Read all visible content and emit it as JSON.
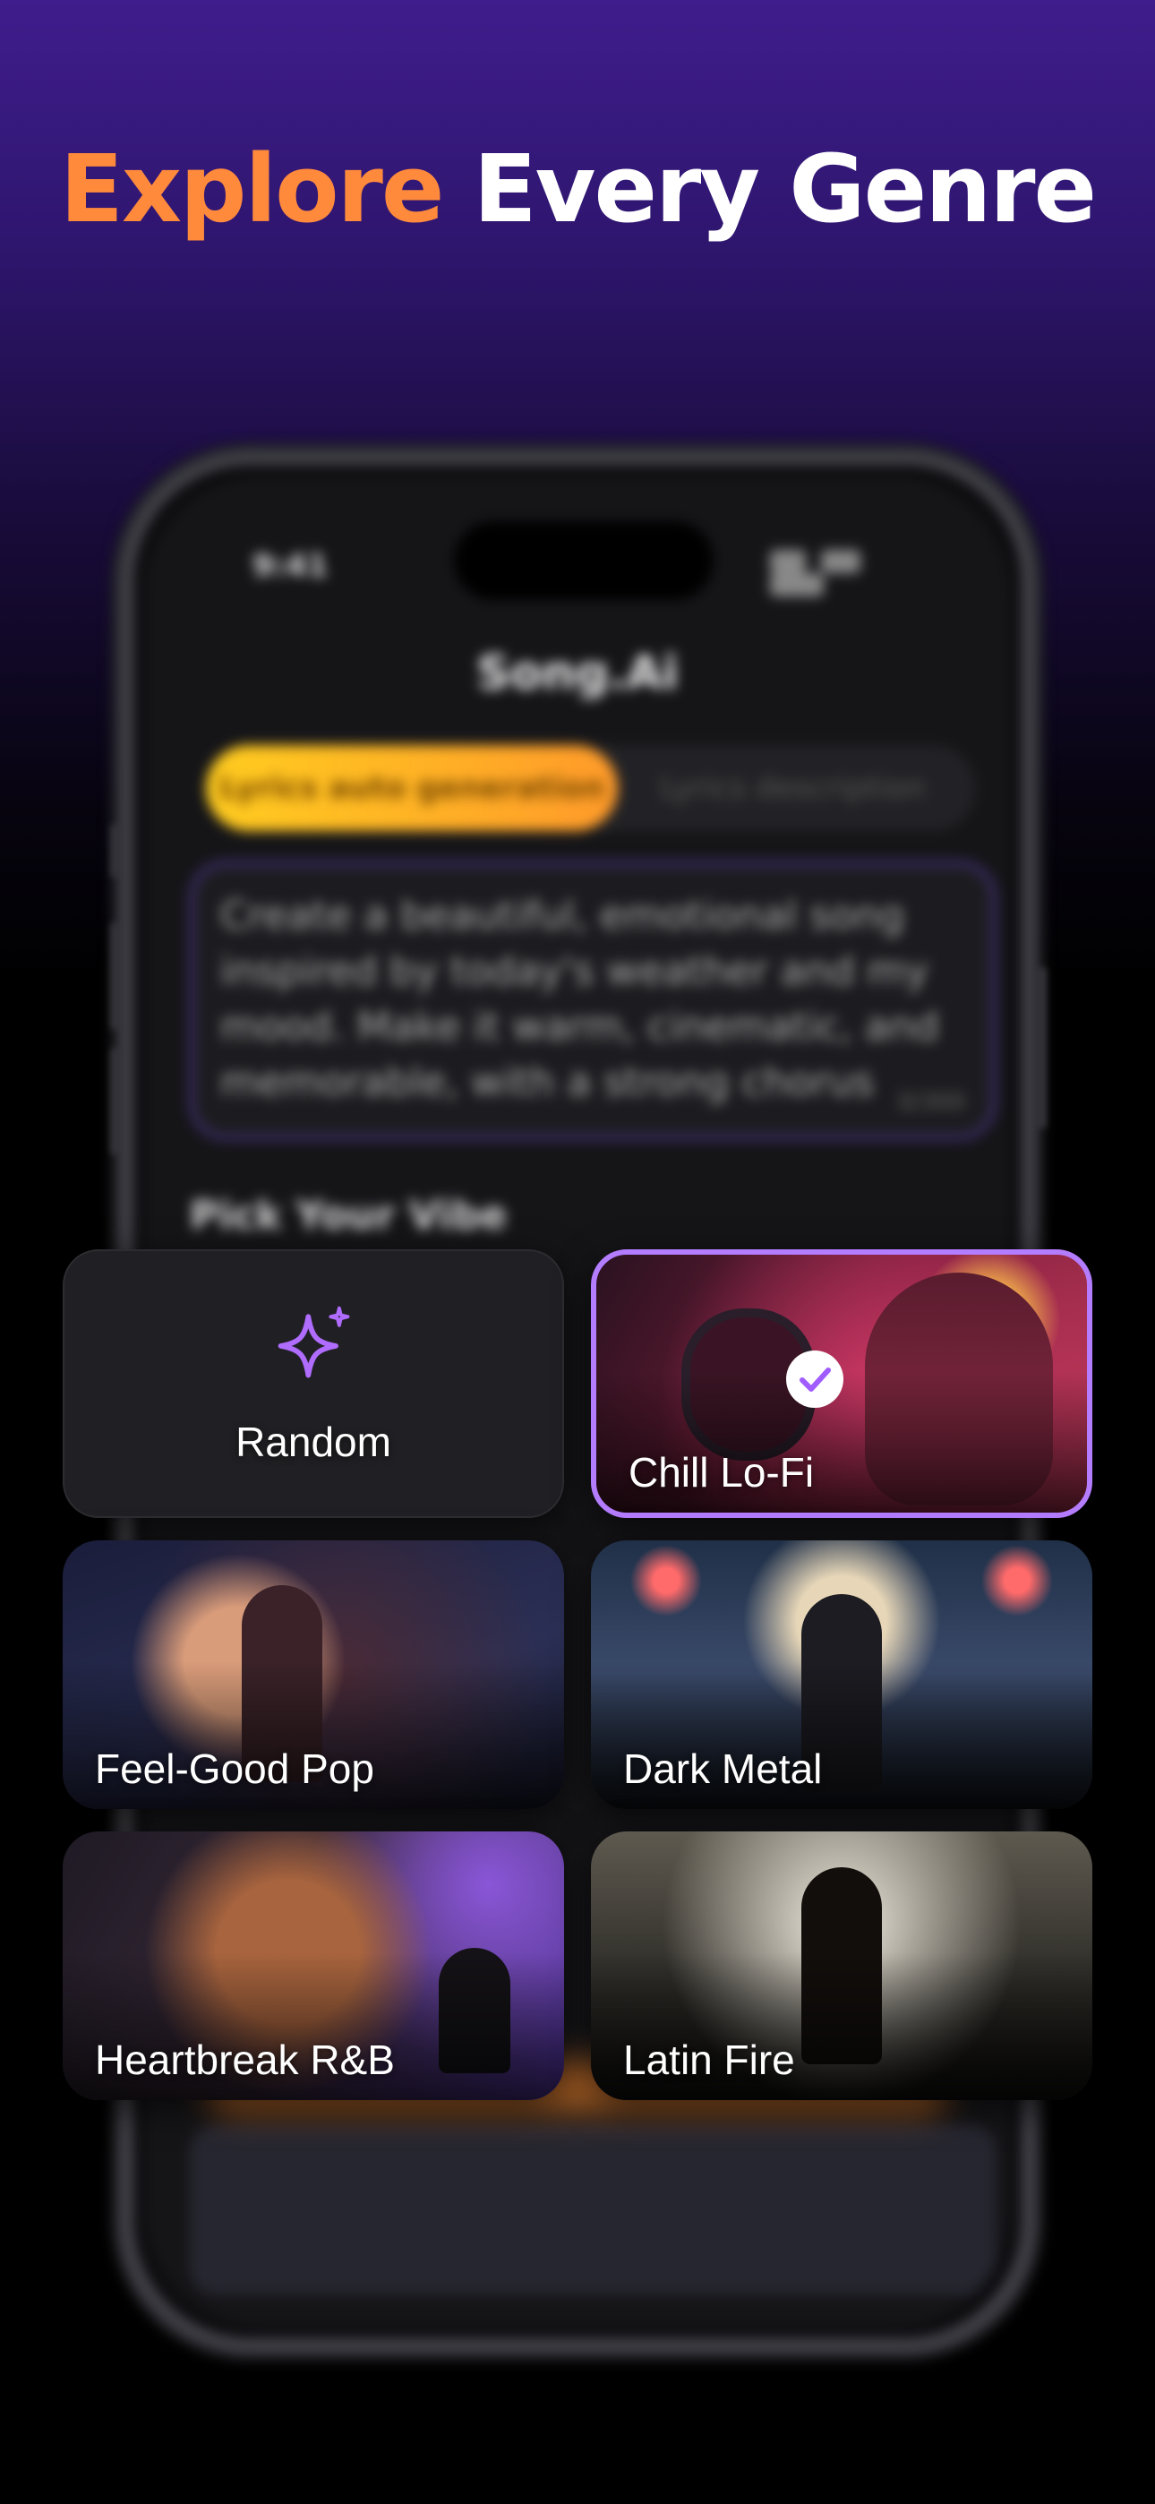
{
  "headline": {
    "accent": "Explore",
    "rest": "Every Genre"
  },
  "colors": {
    "accent": "#ff8a3c",
    "selected_border": "#b47cff",
    "sparkle": "#b06cff"
  },
  "phone": {
    "status_time": "9:41",
    "app_title": "Song.Ai",
    "tabs": {
      "active": "Lyrics auto generation",
      "inactive": "Lyrics description"
    },
    "prompt_text": "Create a beautiful, emotional song inspired by today's weather and my mood. Make it warm, cinematic, and memorable, with a strong chorus",
    "prompt_count": "0/300",
    "section_label": "Pick Your Vibe"
  },
  "genres": {
    "random": {
      "label": "Random",
      "icon": "sparkle-icon"
    },
    "lofi": {
      "label": "Chill Lo-Fi",
      "selected": true,
      "icon": "check-icon"
    },
    "pop": {
      "label": "Feel-Good Pop"
    },
    "metal": {
      "label": "Dark Metal"
    },
    "rnb": {
      "label": "Heartbreak R&B"
    },
    "latin": {
      "label": "Latin Fire"
    }
  }
}
